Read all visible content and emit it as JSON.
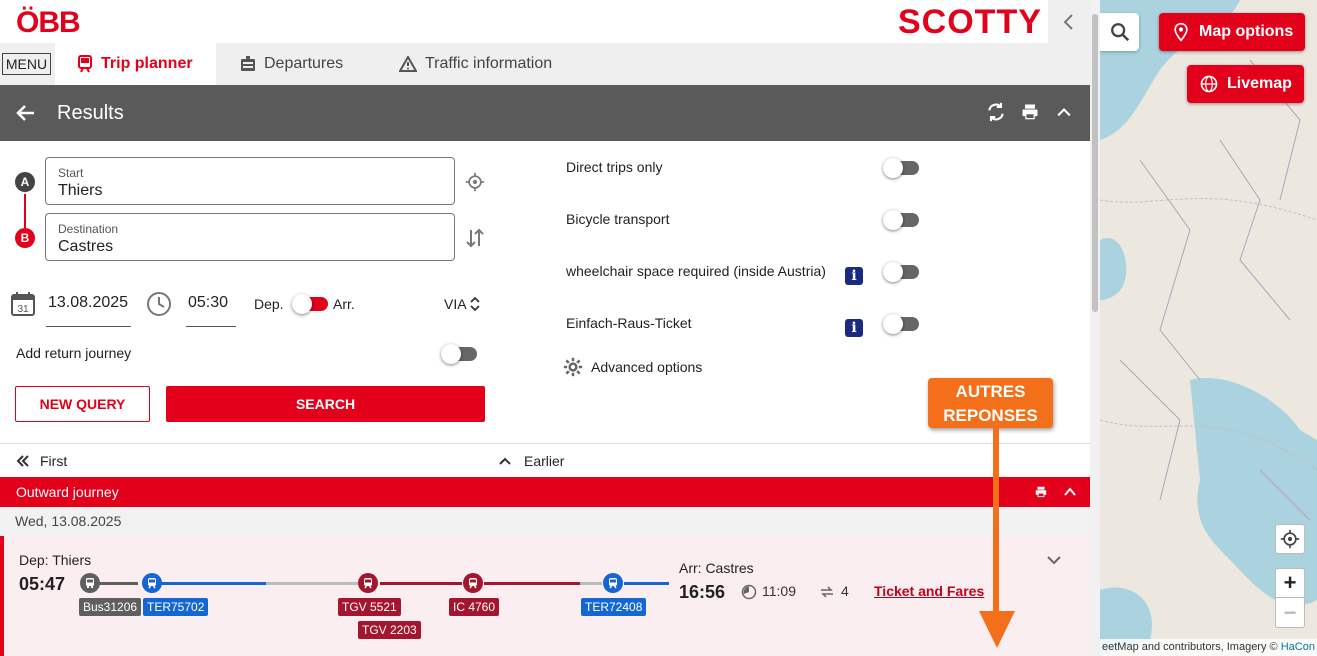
{
  "header": {
    "logo": "ÖBB",
    "brand": "SCOTTY",
    "collapse_icon": "chevron-left-icon"
  },
  "nav": {
    "menu_label": "MENU",
    "tabs": [
      {
        "label": "Trip planner",
        "icon": "train-icon",
        "active": true
      },
      {
        "label": "Departures",
        "icon": "departures-board-icon",
        "active": false
      },
      {
        "label": "Traffic information",
        "icon": "warning-triangle-icon",
        "active": false
      }
    ]
  },
  "results_bar": {
    "title": "Results",
    "icons": [
      "refresh-icon",
      "print-icon",
      "chevron-up-icon"
    ]
  },
  "form": {
    "start_label": "Start",
    "start_value": "Thiers",
    "destination_label": "Destination",
    "destination_value": "Castres",
    "marker_a": "A",
    "marker_b": "B",
    "date": "13.08.2025",
    "calendar_day": "31",
    "time": "05:30",
    "dep_label": "Dep.",
    "arr_label": "Arr.",
    "via_label": "VIA",
    "return_label": "Add return journey",
    "new_query_label": "NEW QUERY",
    "search_label": "SEARCH"
  },
  "options": {
    "items": [
      {
        "label": "Direct trips only",
        "info": false
      },
      {
        "label": "Bicycle transport",
        "info": false
      },
      {
        "label": "wheelchair space required (inside Austria)",
        "info": true
      },
      {
        "label": "Einfach-Raus-Ticket",
        "info": true
      }
    ],
    "info_glyph": "i",
    "advanced_label": "Advanced options"
  },
  "annotation": {
    "line1": "AUTRES",
    "line2": "REPONSES",
    "color": "#f46f19"
  },
  "paging": {
    "first_label": "First",
    "earlier_label": "Earlier"
  },
  "journey": {
    "section_label": "Outward journey",
    "date": "Wed, 13.08.2025",
    "dep_label": "Dep: Thiers",
    "dep_time": "05:47",
    "arr_label": "Arr: Castres",
    "arr_time": "16:56",
    "duration": "11:09",
    "changes": "4",
    "ticket_label": "Ticket and Fares",
    "legs": [
      "Bus31206",
      "TER75702",
      "TGV 5521",
      "TGV 2203",
      "IC 4760",
      "TER72408"
    ]
  },
  "map": {
    "options_label": "Map options",
    "livemap_label": "Livemap",
    "zoom_in": "+",
    "zoom_out": "−",
    "attrib_text": "eetMap and contributors, Imagery ©",
    "attrib_link": "HaCon"
  },
  "colors": {
    "brand_red": "#e2001a",
    "header_grey": "#5a5a5a",
    "bus_grey": "#5f5f5f",
    "ter_blue": "#1466d3",
    "tgv_red": "#a3162f"
  }
}
